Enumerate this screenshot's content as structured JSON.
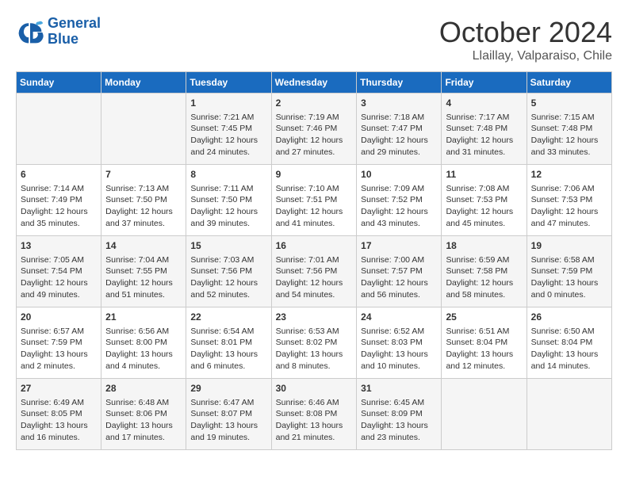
{
  "header": {
    "logo_line1": "General",
    "logo_line2": "Blue",
    "month": "October 2024",
    "location": "Llaillay, Valparaiso, Chile"
  },
  "days_of_week": [
    "Sunday",
    "Monday",
    "Tuesday",
    "Wednesday",
    "Thursday",
    "Friday",
    "Saturday"
  ],
  "weeks": [
    [
      {
        "day": "",
        "content": ""
      },
      {
        "day": "",
        "content": ""
      },
      {
        "day": "1",
        "content": "Sunrise: 7:21 AM\nSunset: 7:45 PM\nDaylight: 12 hours and 24 minutes."
      },
      {
        "day": "2",
        "content": "Sunrise: 7:19 AM\nSunset: 7:46 PM\nDaylight: 12 hours and 27 minutes."
      },
      {
        "day": "3",
        "content": "Sunrise: 7:18 AM\nSunset: 7:47 PM\nDaylight: 12 hours and 29 minutes."
      },
      {
        "day": "4",
        "content": "Sunrise: 7:17 AM\nSunset: 7:48 PM\nDaylight: 12 hours and 31 minutes."
      },
      {
        "day": "5",
        "content": "Sunrise: 7:15 AM\nSunset: 7:48 PM\nDaylight: 12 hours and 33 minutes."
      }
    ],
    [
      {
        "day": "6",
        "content": "Sunrise: 7:14 AM\nSunset: 7:49 PM\nDaylight: 12 hours and 35 minutes."
      },
      {
        "day": "7",
        "content": "Sunrise: 7:13 AM\nSunset: 7:50 PM\nDaylight: 12 hours and 37 minutes."
      },
      {
        "day": "8",
        "content": "Sunrise: 7:11 AM\nSunset: 7:50 PM\nDaylight: 12 hours and 39 minutes."
      },
      {
        "day": "9",
        "content": "Sunrise: 7:10 AM\nSunset: 7:51 PM\nDaylight: 12 hours and 41 minutes."
      },
      {
        "day": "10",
        "content": "Sunrise: 7:09 AM\nSunset: 7:52 PM\nDaylight: 12 hours and 43 minutes."
      },
      {
        "day": "11",
        "content": "Sunrise: 7:08 AM\nSunset: 7:53 PM\nDaylight: 12 hours and 45 minutes."
      },
      {
        "day": "12",
        "content": "Sunrise: 7:06 AM\nSunset: 7:53 PM\nDaylight: 12 hours and 47 minutes."
      }
    ],
    [
      {
        "day": "13",
        "content": "Sunrise: 7:05 AM\nSunset: 7:54 PM\nDaylight: 12 hours and 49 minutes."
      },
      {
        "day": "14",
        "content": "Sunrise: 7:04 AM\nSunset: 7:55 PM\nDaylight: 12 hours and 51 minutes."
      },
      {
        "day": "15",
        "content": "Sunrise: 7:03 AM\nSunset: 7:56 PM\nDaylight: 12 hours and 52 minutes."
      },
      {
        "day": "16",
        "content": "Sunrise: 7:01 AM\nSunset: 7:56 PM\nDaylight: 12 hours and 54 minutes."
      },
      {
        "day": "17",
        "content": "Sunrise: 7:00 AM\nSunset: 7:57 PM\nDaylight: 12 hours and 56 minutes."
      },
      {
        "day": "18",
        "content": "Sunrise: 6:59 AM\nSunset: 7:58 PM\nDaylight: 12 hours and 58 minutes."
      },
      {
        "day": "19",
        "content": "Sunrise: 6:58 AM\nSunset: 7:59 PM\nDaylight: 13 hours and 0 minutes."
      }
    ],
    [
      {
        "day": "20",
        "content": "Sunrise: 6:57 AM\nSunset: 7:59 PM\nDaylight: 13 hours and 2 minutes."
      },
      {
        "day": "21",
        "content": "Sunrise: 6:56 AM\nSunset: 8:00 PM\nDaylight: 13 hours and 4 minutes."
      },
      {
        "day": "22",
        "content": "Sunrise: 6:54 AM\nSunset: 8:01 PM\nDaylight: 13 hours and 6 minutes."
      },
      {
        "day": "23",
        "content": "Sunrise: 6:53 AM\nSunset: 8:02 PM\nDaylight: 13 hours and 8 minutes."
      },
      {
        "day": "24",
        "content": "Sunrise: 6:52 AM\nSunset: 8:03 PM\nDaylight: 13 hours and 10 minutes."
      },
      {
        "day": "25",
        "content": "Sunrise: 6:51 AM\nSunset: 8:04 PM\nDaylight: 13 hours and 12 minutes."
      },
      {
        "day": "26",
        "content": "Sunrise: 6:50 AM\nSunset: 8:04 PM\nDaylight: 13 hours and 14 minutes."
      }
    ],
    [
      {
        "day": "27",
        "content": "Sunrise: 6:49 AM\nSunset: 8:05 PM\nDaylight: 13 hours and 16 minutes."
      },
      {
        "day": "28",
        "content": "Sunrise: 6:48 AM\nSunset: 8:06 PM\nDaylight: 13 hours and 17 minutes."
      },
      {
        "day": "29",
        "content": "Sunrise: 6:47 AM\nSunset: 8:07 PM\nDaylight: 13 hours and 19 minutes."
      },
      {
        "day": "30",
        "content": "Sunrise: 6:46 AM\nSunset: 8:08 PM\nDaylight: 13 hours and 21 minutes."
      },
      {
        "day": "31",
        "content": "Sunrise: 6:45 AM\nSunset: 8:09 PM\nDaylight: 13 hours and 23 minutes."
      },
      {
        "day": "",
        "content": ""
      },
      {
        "day": "",
        "content": ""
      }
    ]
  ]
}
